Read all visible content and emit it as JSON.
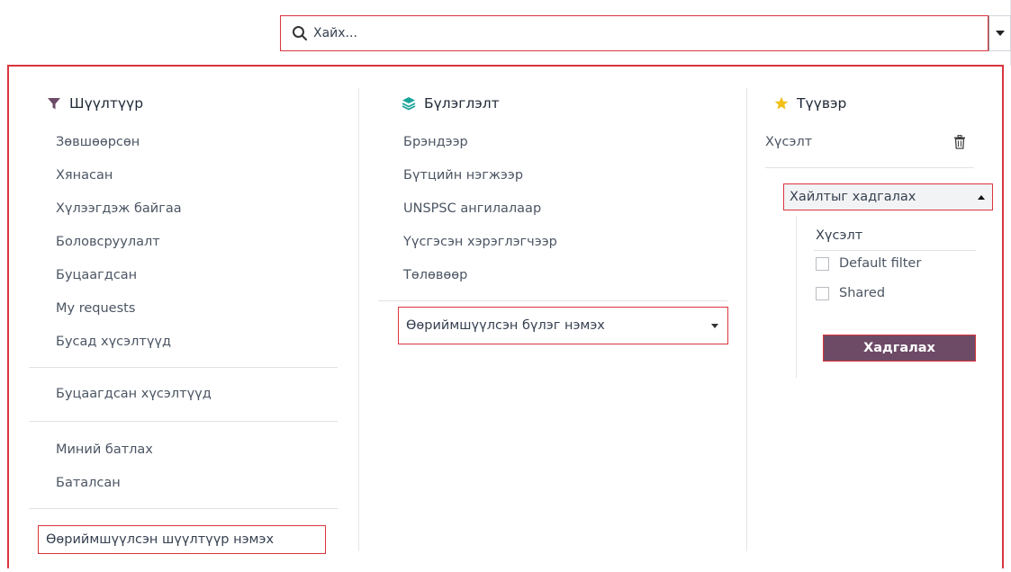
{
  "search": {
    "placeholder": "Хайх...",
    "dropdown_icon": "caret-down-icon",
    "icon": "search-icon"
  },
  "filters": {
    "title": "Шүүлтүүр",
    "icon": "funnel-icon",
    "icon_color": "#6d4b67",
    "group1": [
      "Зөвшөөрсөн",
      "Хянасан",
      "Хүлээгдэж байгаа",
      "Боловсруулалт",
      "Буцаагдсан",
      "My requests",
      "Бусад хүсэлтүүд"
    ],
    "group2": [
      "Буцаагдсан хүсэлтүүд"
    ],
    "group3": [
      "Миний батлах",
      "Баталсан"
    ],
    "add_custom": "Өөриймшүүлсэн шүүлтүүр нэмэх"
  },
  "groupby": {
    "title": "Бүлэглэлт",
    "icon": "layers-icon",
    "icon_color": "#1aa39a",
    "items": [
      "Брэндээр",
      "Бүтцийн нэгжээр",
      "UNSPSC ангилалаар",
      "Үүсгэсэн хэрэглэгчээр",
      "Төлөвөөр"
    ],
    "add_custom": "Өөриймшүүлсэн бүлэг нэмэх"
  },
  "favorites": {
    "title": "Түүвэр",
    "icon": "star-icon",
    "icon_color": "#f3c019",
    "items": [
      {
        "label": "Хүсэлт",
        "icon": "trash-icon"
      }
    ],
    "save_search_toggle": "Хайлтыг хадгалах",
    "form": {
      "name_value": "Хүсэлт",
      "checkboxes": [
        "Default filter",
        "Shared"
      ],
      "save_button": "Хадгалах"
    }
  },
  "colors": {
    "accent": "#6d4b67",
    "highlight_border": "#d9363e"
  }
}
